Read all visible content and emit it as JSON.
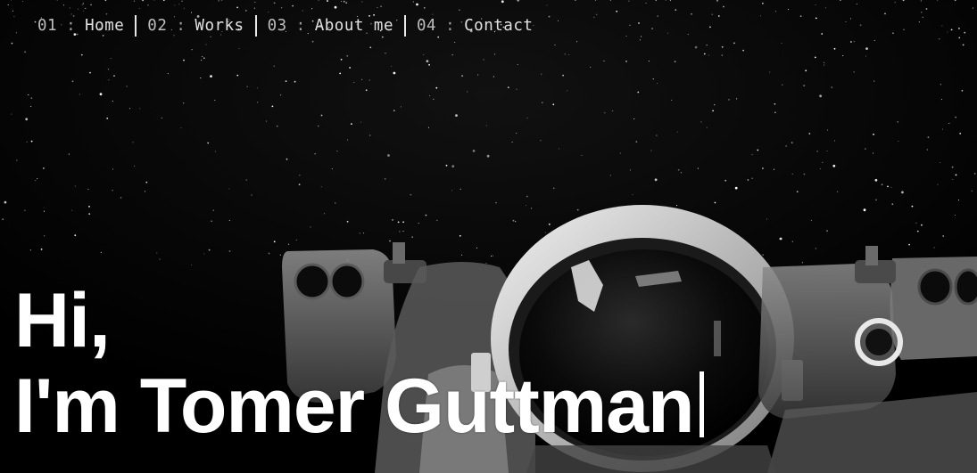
{
  "nav": {
    "items": [
      {
        "number": "01",
        "separator": ":",
        "label": "Home"
      },
      {
        "number": "02",
        "separator": ":",
        "label": "Works"
      },
      {
        "number": "03",
        "separator": ":",
        "label": "About me"
      },
      {
        "number": "04",
        "separator": ":",
        "label": "Contact"
      }
    ]
  },
  "hero": {
    "greeting": "Hi,",
    "intro": "I'm Tomer Guttman",
    "background_image": "astronaut-in-space-photo"
  },
  "colors": {
    "background": "#000000",
    "text": "#ffffff",
    "nav_text": "#d6d6d6"
  }
}
